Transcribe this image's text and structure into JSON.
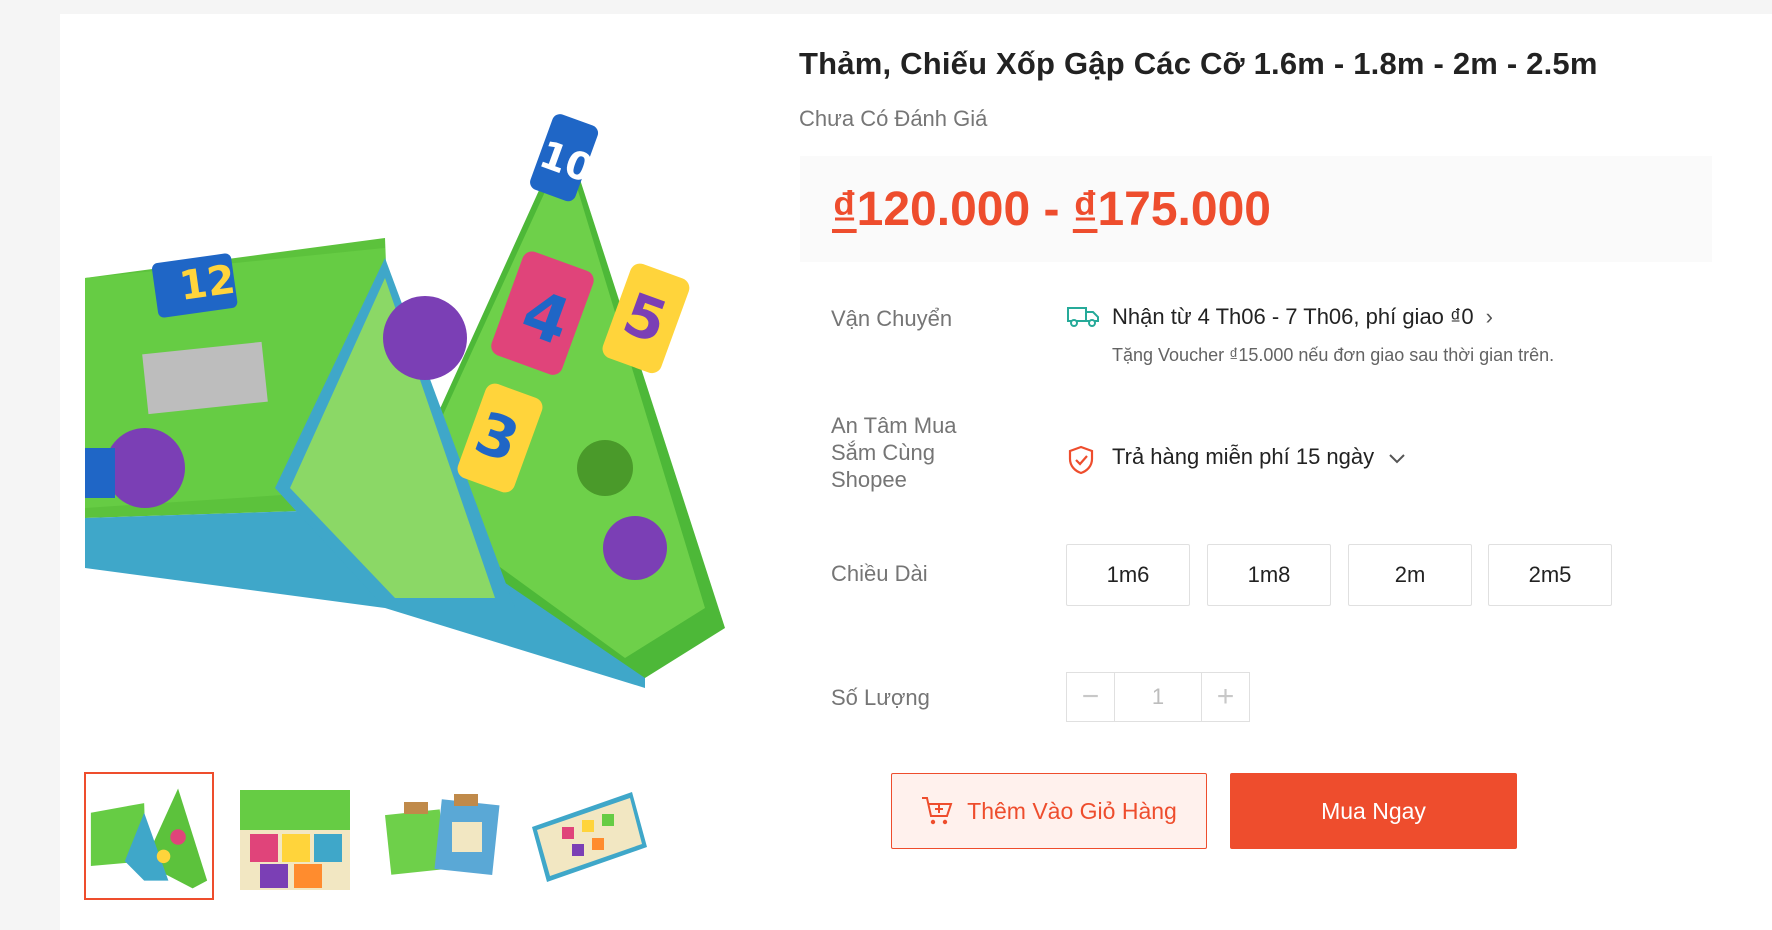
{
  "product": {
    "title": "Thảm, Chiếu Xốp Gập Các Cỡ 1.6m - 1.8m - 2m - 2.5m",
    "rating_text": "Chưa Có Đánh Giá",
    "price": {
      "currency_symbol": "₫",
      "min": "120.000",
      "separator": " - ",
      "max": "175.000"
    }
  },
  "shipping": {
    "label": "Vận Chuyển",
    "icon": "truck-icon",
    "main": "Nhận từ 4 Th06 - 7 Th06, phí giao ₫0",
    "sub": "Tặng Voucher ₫15.000 nếu đơn giao sau thời gian trên.",
    "chevron": "›"
  },
  "guarantee": {
    "label": "An Tâm Mua Sắm Cùng Shopee",
    "icon": "shield-check-icon",
    "text": "Trả hàng miễn phí 15 ngày"
  },
  "variants": {
    "label": "Chiều Dài",
    "options": [
      "1m6",
      "1m8",
      "2m",
      "2m5"
    ]
  },
  "quantity": {
    "label": "Số Lượng",
    "value": "1",
    "minus": "−",
    "plus": "+"
  },
  "actions": {
    "add_to_cart": "Thêm Vào Giỏ Hàng",
    "buy_now": "Mua Ngay"
  },
  "colors": {
    "accent": "#ee4d2d",
    "accent_light": "#fff1ed",
    "teal": "#26aa99"
  }
}
